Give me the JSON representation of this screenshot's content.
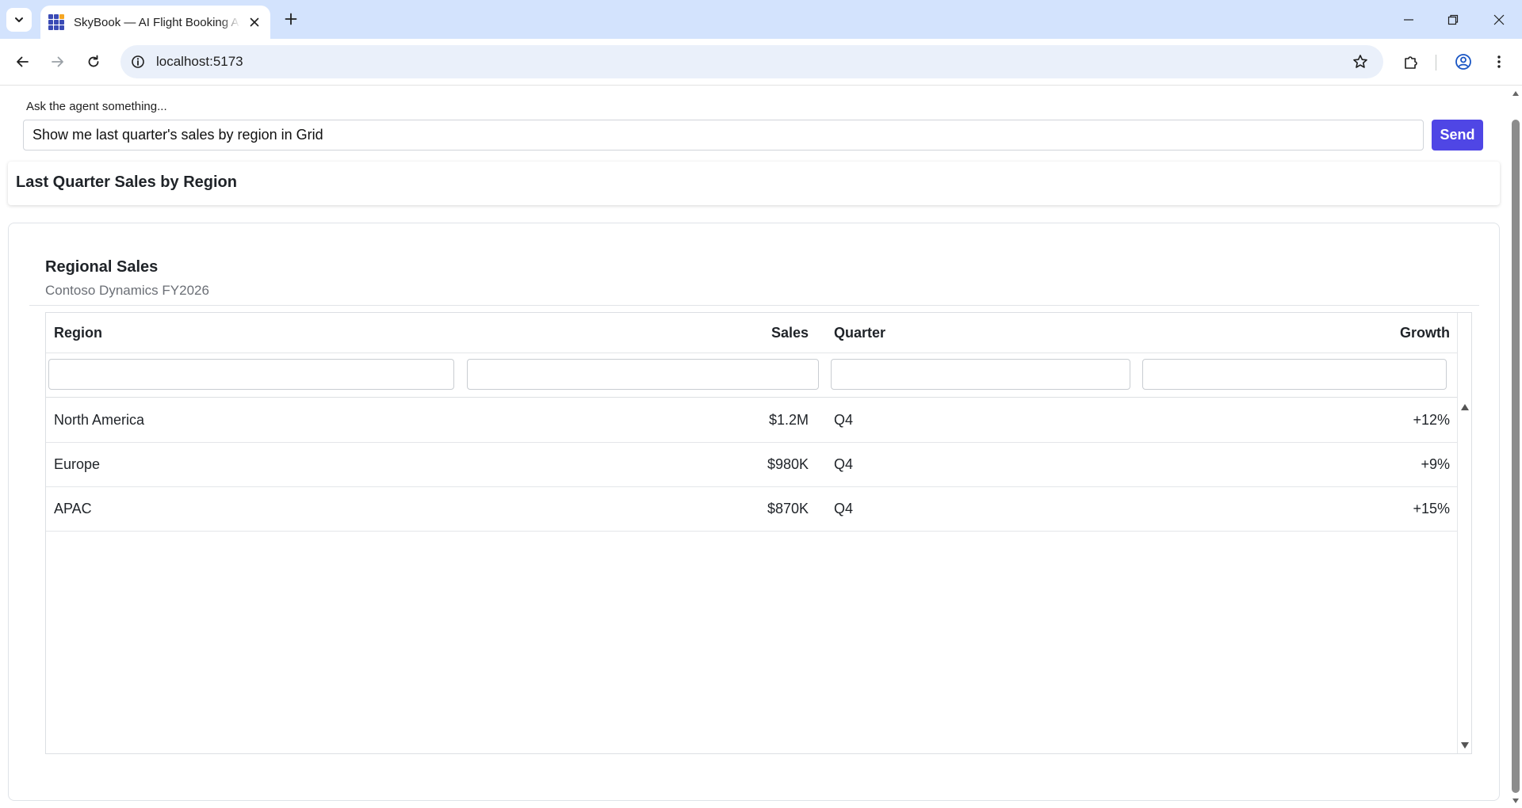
{
  "browser": {
    "tab_title": "SkyBook — AI Flight Booking Assistant",
    "url": "localhost:5173"
  },
  "icons": {
    "tab_list": "chevron-down-icon",
    "favicon": "app-grid-icon",
    "tab_close": "close-icon",
    "new_tab": "plus-icon",
    "minimize": "minimize-icon",
    "restore": "restore-icon",
    "window_close": "close-icon",
    "back": "arrow-left-icon",
    "forward": "arrow-right-icon",
    "reload": "reload-icon",
    "site_info": "info-icon",
    "bookmark": "star-icon",
    "extensions": "puzzle-icon",
    "profile": "profile-icon",
    "menu": "more-vert-icon"
  },
  "ask": {
    "label": "Ask the agent something...",
    "value": "Show me last quarter's sales by region in Grid",
    "send_label": "Send"
  },
  "colors": {
    "accent": "#4f46e5",
    "tabbar": "#d3e3fd",
    "omnibox": "#eaf0fa"
  },
  "result": {
    "title": "Last Quarter Sales by Region"
  },
  "grid": {
    "title": "Regional Sales",
    "subtitle": "Contoso Dynamics FY2026",
    "columns": [
      "Region",
      "Sales",
      "Quarter",
      "Growth"
    ],
    "rows": [
      [
        "North America",
        "$1.2M",
        "Q4",
        "+12%"
      ],
      [
        "Europe",
        "$980K",
        "Q4",
        "+9%"
      ],
      [
        "APAC",
        "$870K",
        "Q4",
        "+15%"
      ]
    ]
  }
}
